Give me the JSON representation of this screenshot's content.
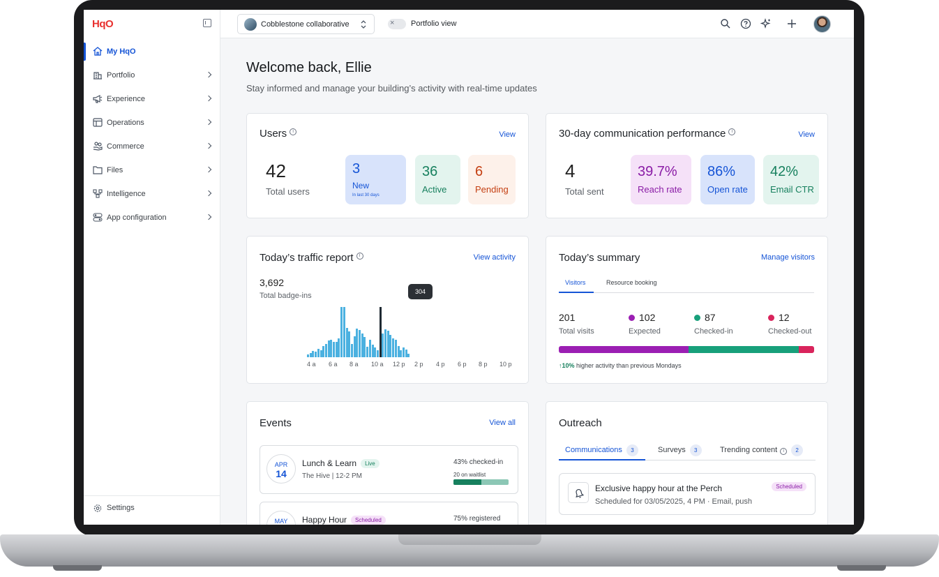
{
  "app": {
    "logo": "HqO"
  },
  "sidebar": {
    "items": [
      {
        "label": "My HqO",
        "icon": "home-icon",
        "active": true
      },
      {
        "label": "Portfolio",
        "icon": "buildings-icon"
      },
      {
        "label": "Experience",
        "icon": "megaphone-icon"
      },
      {
        "label": "Operations",
        "icon": "layout-icon"
      },
      {
        "label": "Commerce",
        "icon": "hand-coins-icon"
      },
      {
        "label": "Files",
        "icon": "folder-icon"
      },
      {
        "label": "Intelligence",
        "icon": "nodes-icon"
      },
      {
        "label": "App configuration",
        "icon": "toggles-icon"
      }
    ],
    "settings_label": "Settings"
  },
  "topbar": {
    "building": "Cobblestone collaborative",
    "portfolio_view": "Portfolio view",
    "icons": [
      "search-icon",
      "help-icon",
      "sparkle-icon",
      "plus-icon",
      "avatar"
    ]
  },
  "main": {
    "title": "Welcome back, Ellie",
    "subtitle": "Stay informed and manage your building’s activity with real-time updates"
  },
  "users": {
    "title": "Users",
    "view": "View",
    "total": "42",
    "total_label": "Total users",
    "new": "3",
    "new_label": "New",
    "new_sub": "In last 30 days",
    "active": "36",
    "active_label": "Active",
    "pending": "6",
    "pending_label": "Pending"
  },
  "comms": {
    "title": "30-day communication performance",
    "view": "View",
    "total": "4",
    "total_label": "Total sent",
    "reach": "39.7%",
    "reach_label": "Reach rate",
    "open": "86%",
    "open_label": "Open rate",
    "ctr": "42%",
    "ctr_label": "Email CTR"
  },
  "traffic": {
    "title": "Today’s traffic report",
    "link": "View activity",
    "total": "3,692",
    "total_label": "Total badge-ins",
    "tooltip": "304",
    "ticks": [
      "4 a",
      "6 a",
      "8 a",
      "10 a",
      "12 p",
      "2 p",
      "4 p",
      "6 p",
      "8 p",
      "10 p"
    ]
  },
  "chart_data": {
    "type": "bar",
    "values": [
      5,
      9,
      13,
      11,
      17,
      14,
      22,
      26,
      33,
      35,
      31,
      30,
      38,
      100,
      100,
      59,
      52,
      26,
      42,
      57,
      54,
      47,
      40,
      21,
      35,
      25,
      19,
      14,
      100,
      47,
      56,
      53,
      44,
      38,
      35,
      22,
      14,
      20,
      15,
      7
    ],
    "highlight_index": 28,
    "tick_labels": [
      "4 a",
      "6 a",
      "8 a",
      "10 a",
      "12 p",
      "2 p",
      "4 p",
      "6 p",
      "8 p",
      "10 p"
    ]
  },
  "summary": {
    "title": "Today’s summary",
    "link": "Manage visitors",
    "tabs": [
      "Visitors",
      "Resource booking"
    ],
    "total": "201",
    "total_label": "Total visits",
    "expected": "102",
    "expected_label": "Expected",
    "checked_in": "87",
    "checked_in_label": "Checked-in",
    "checked_out": "12",
    "checked_out_label": "Checked-out",
    "trend": "10%",
    "trend_text": "higher activity than previous Mondays",
    "colors": {
      "expected": "#9b1fb3",
      "checked_in": "#18a07b",
      "checked_out": "#d9245c"
    }
  },
  "events": {
    "title": "Events",
    "link": "View all",
    "items": [
      {
        "month": "APR",
        "day": "14",
        "name": "Lunch & Learn",
        "badge": "Live",
        "sub": "The Hive | 12-2 PM",
        "stat": "43% checked-in",
        "wait": "20 on waitlist",
        "progress": 0.5
      },
      {
        "month": "MAY",
        "name": "Happy Hour",
        "badge": "Scheduled",
        "stat": "75% registered"
      }
    ]
  },
  "outreach": {
    "title": "Outreach",
    "tabs": [
      {
        "label": "Communications",
        "count": "3"
      },
      {
        "label": "Surveys",
        "count": "3"
      },
      {
        "label": "Trending content",
        "count": "2"
      }
    ],
    "message": {
      "title": "Exclusive happy hour at the Perch",
      "sub": "Scheduled for 03/05/2025, 4 PM · Email, push",
      "badge": "Scheduled"
    }
  }
}
